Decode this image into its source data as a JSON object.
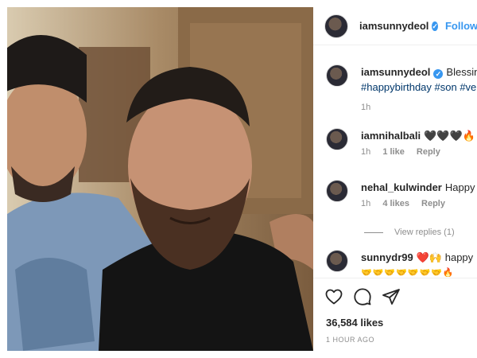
{
  "post": {
    "author": "iamsunnydeol",
    "follow_label": "Follow",
    "caption": {
      "text": "Blessings",
      "hashtags": "#happybirthday #son #ve"
    },
    "caption_time": "1h"
  },
  "comments": [
    {
      "username": "iamnihalbali",
      "text": "🖤🖤🖤🔥🔥",
      "time": "1h",
      "likes": "1 like",
      "reply_label": "Reply"
    },
    {
      "username": "nehal_kulwinder",
      "text": "Happy",
      "time": "1h",
      "likes": "4 likes",
      "reply_label": "Reply",
      "view_replies": "View replies (1)"
    },
    {
      "username": "sunnydr99",
      "text": "❤️🙌 happy",
      "emoji_line": "🤝🤝🤝🤝🤝🤝🤝🔥"
    }
  ],
  "actions": {
    "like_icon": "heart-icon",
    "comment_icon": "comment-icon",
    "share_icon": "share-icon",
    "likes_count": "36,584 likes",
    "time_ago": "1 HOUR AGO"
  }
}
